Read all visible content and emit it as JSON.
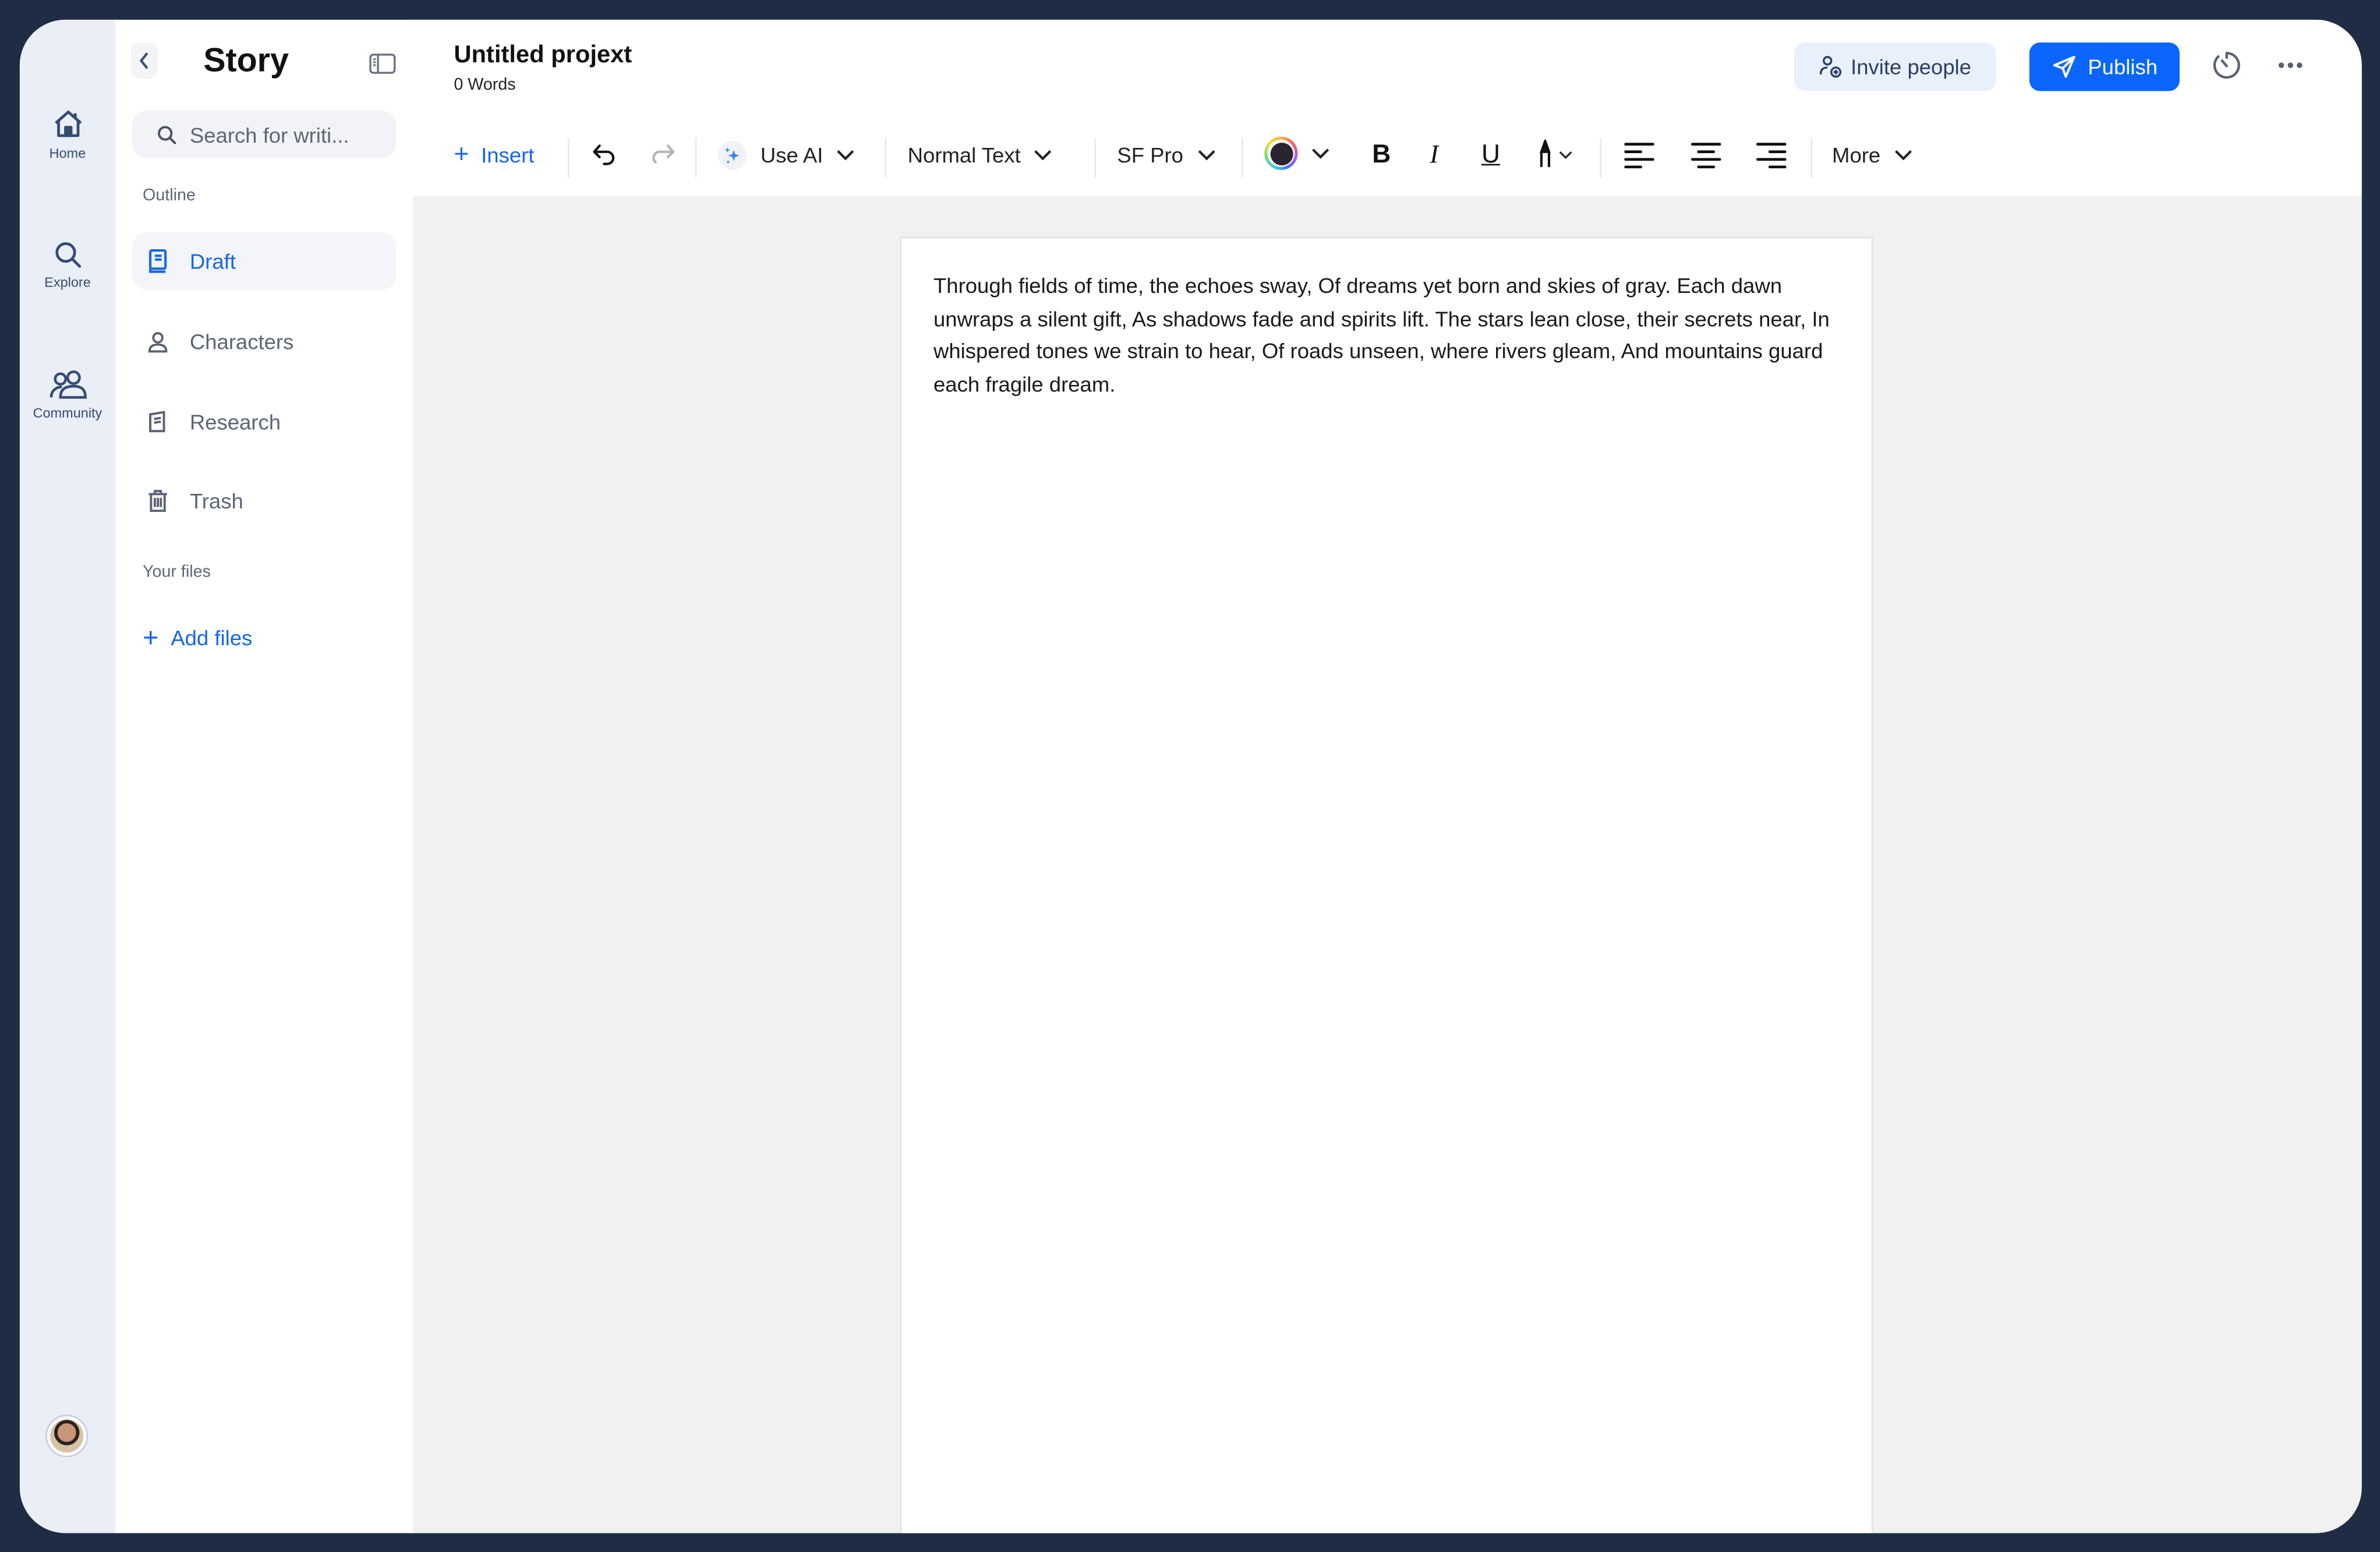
{
  "rail": {
    "items": [
      {
        "label": "Home",
        "icon": "home-icon"
      },
      {
        "label": "Explore",
        "icon": "search-icon"
      },
      {
        "label": "Community",
        "icon": "community-icon"
      }
    ],
    "avatar_alt": "User avatar"
  },
  "sidebar": {
    "title": "Story",
    "search": {
      "placeholder": "Search for writi...",
      "value": ""
    },
    "outline_label": "Outline",
    "items": [
      {
        "label": "Draft",
        "icon": "draft-book-icon",
        "active": true
      },
      {
        "label": "Characters",
        "icon": "person-icon",
        "active": false
      },
      {
        "label": "Research",
        "icon": "research-notebook-icon",
        "active": false
      },
      {
        "label": "Trash",
        "icon": "trash-icon",
        "active": false
      }
    ],
    "files_label": "Your files",
    "add_files_label": "Add files"
  },
  "header": {
    "project_title": "Untitled projext",
    "word_count": "0 Words",
    "invite_label": "Invite people",
    "publish_label": "Publish"
  },
  "toolbar": {
    "insert_label": "Insert",
    "ai_label": "Use AI",
    "text_style": "Normal Text",
    "font": "SF Pro",
    "text_color": "#2a2430",
    "more_label": "More",
    "bold": "B",
    "italic": "I",
    "underline": "U"
  },
  "document": {
    "text": "Through fields of time, the echoes sway, Of dreams yet born and skies of gray. Each dawn unwraps a silent gift, As shadows fade and spirits lift. The stars lean close, their secrets near, In whispered tones we strain to hear, Of roads unseen, where rivers gleam, And mountains guard each fragile dream."
  },
  "colors": {
    "accent": "#0a66ff",
    "frame": "#1e2c44",
    "rail_bg": "#eaeef6",
    "canvas_bg": "#f1f1f1"
  }
}
